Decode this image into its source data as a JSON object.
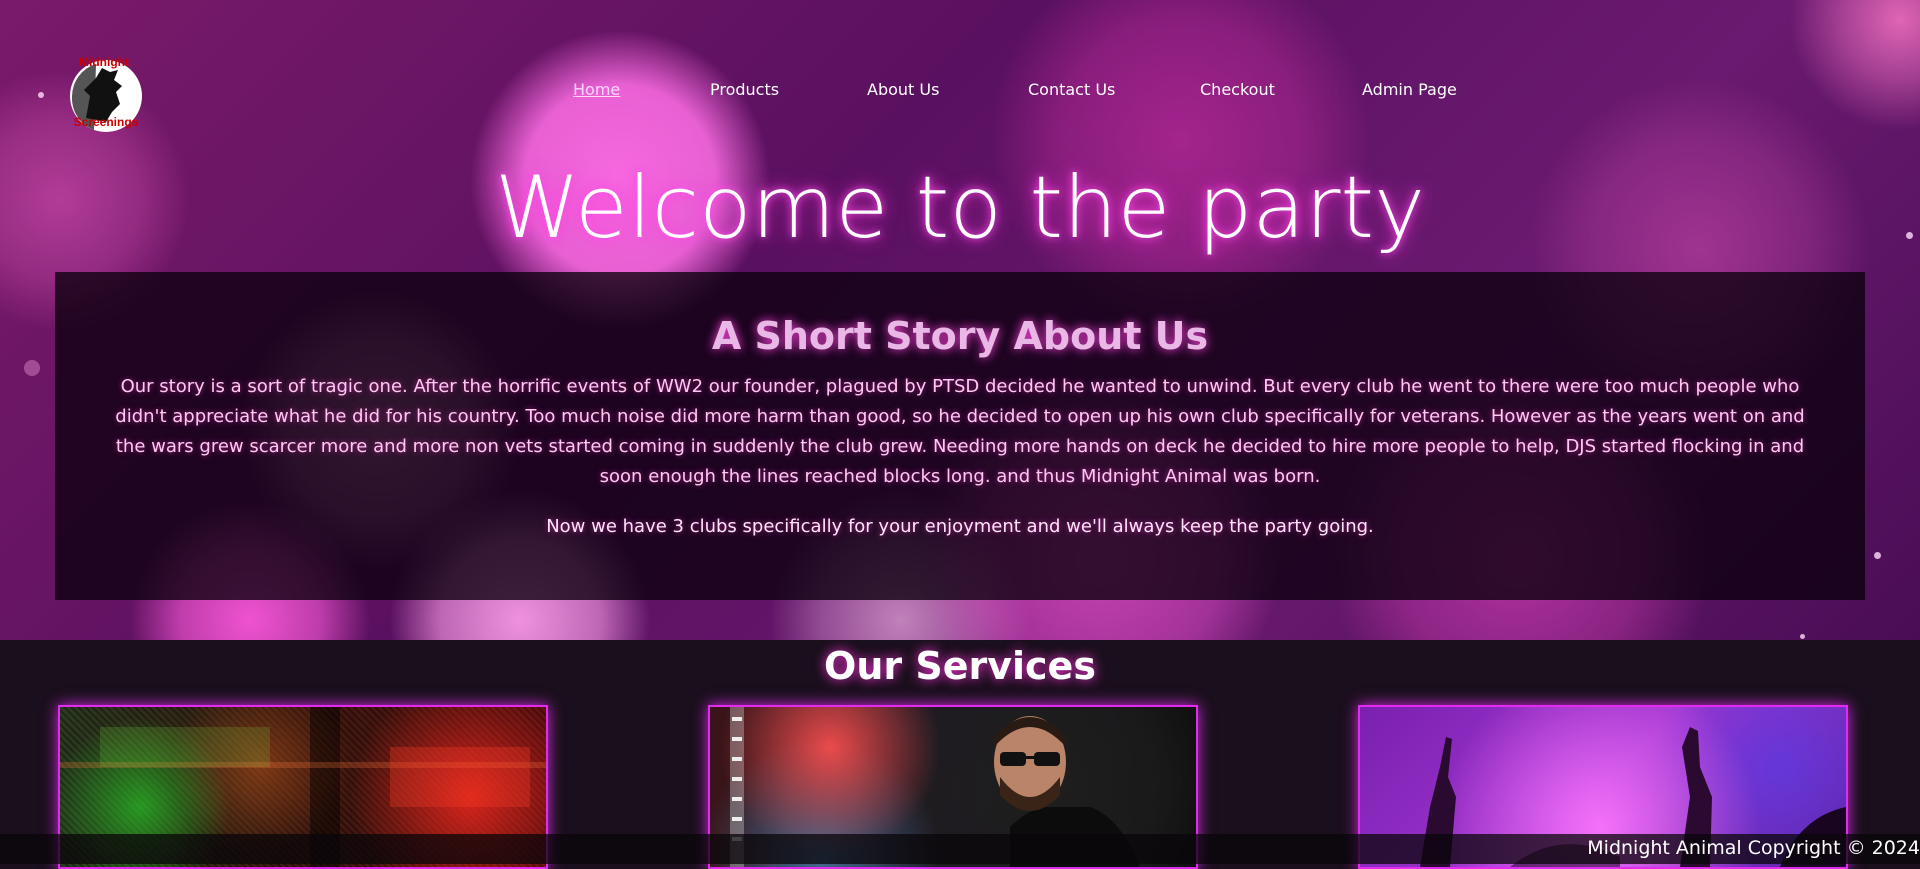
{
  "brand": {
    "logo_line1": "Midnight",
    "logo_line2": "Screenings",
    "icon": "wolf-silhouette-icon"
  },
  "nav": {
    "items": [
      {
        "label": "Home",
        "active": true
      },
      {
        "label": "Products"
      },
      {
        "label": "About Us"
      },
      {
        "label": "Contact Us"
      },
      {
        "label": "Checkout"
      },
      {
        "label": "Admin Page"
      }
    ]
  },
  "hero": {
    "title": "Welcome to the party"
  },
  "story": {
    "heading": "A Short Story About Us",
    "paragraph1": "Our story is a sort of tragic one. After the horrific events of WW2 our founder, plagued by PTSD decided he wanted to unwind. But every club he went to there were too much people who didn't appreciate what he did for his country. Too much noise did more harm than good, so he decided to open up his own club specifically for veterans. However as the years went on and the wars grew scarcer more and more non vets started coming in suddenly the club grew. Needing more hands on deck he decided to hire more people to help, DJS started flocking in and soon enough the lines reached blocks long. and thus Midnight Animal was born.",
    "paragraph2": "Now we have 3 clubs specifically for your enjoyment and we'll always keep the party going."
  },
  "services": {
    "heading": "Our Services",
    "cards": [
      {
        "image": "neon-club-interior"
      },
      {
        "image": "dj-with-sunglasses"
      },
      {
        "image": "crowd-hands-purple-lights"
      }
    ]
  },
  "footer": {
    "text": "Midnight Animal Copyright © 2024"
  },
  "colors": {
    "accent": "#e12cf0",
    "glow": "#ff33dd",
    "background": "#1a0f1c"
  }
}
